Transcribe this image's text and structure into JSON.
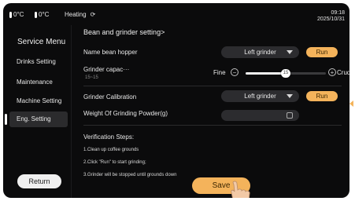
{
  "status": {
    "temp1": "0°C",
    "temp2": "0°C",
    "mode": "Heating",
    "time": "09:18",
    "date": "2025/10/31"
  },
  "sidebar": {
    "title": "Service Menu",
    "items": [
      {
        "label": "Drinks Setting"
      },
      {
        "label": "Maintenance"
      },
      {
        "label": "Machine Setting"
      },
      {
        "label": "Eng. Setting"
      }
    ],
    "return_label": "Return"
  },
  "main": {
    "title": "Bean and grinder setting>",
    "bean_hopper": {
      "label": "Name bean hopper",
      "select_value": "Left grinder",
      "button_label": "Run"
    },
    "grinder_capacity": {
      "label": "Grinder capac···",
      "range": "15~15",
      "left_label": "Fine",
      "right_label": "Crude",
      "value": 15,
      "min": 0,
      "max": 30
    },
    "grinder_calibration": {
      "label": "Grinder Calibration",
      "select_value": "Left grinder",
      "button_label": "Run"
    },
    "weight": {
      "label": "Weight Of Grinding Powder(g)"
    },
    "verification": {
      "title": "Verification Steps:",
      "steps": [
        "1.Clean up coffee grounds",
        "2.Click \"Run\" to start grinding;",
        "3.Grinder will be stopped until grounds down"
      ]
    },
    "save_label": "Save"
  }
}
